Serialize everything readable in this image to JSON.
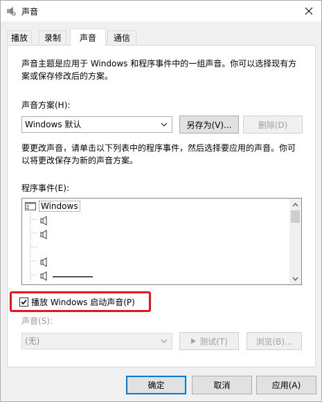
{
  "window": {
    "title": "声音",
    "close_icon": "close-icon"
  },
  "tabs": [
    {
      "label": "播放",
      "active": false
    },
    {
      "label": "录制",
      "active": false
    },
    {
      "label": "声音",
      "active": true
    },
    {
      "label": "通信",
      "active": false
    }
  ],
  "panel": {
    "intro_line1": "声音主题是应用于 Windows 和程序事件中的一组声音。你可以选择现有方",
    "intro_line2": "案或保存修改后的方案。",
    "scheme_label": "声音方案(H):",
    "scheme_value": "Windows 默认",
    "save_as_label": "另存为(V)...",
    "delete_label": "删除(D)",
    "change_line1": "要更改声音，请单击以下列表中的程序事件，然后选择要应用的声音。你可",
    "change_line2": "以将更改保存为新的声音方案。",
    "events_label": "程序事件(E):",
    "events_root": "Windows",
    "startup_checkbox_label": "播放 Windows 启动声音(P)",
    "startup_checked": true,
    "sound_label": "声音(S):",
    "sound_value": "(无)",
    "test_label": "测试(T)",
    "browse_label": "浏览(B)..."
  },
  "footer": {
    "ok_label": "确定",
    "cancel_label": "取消",
    "apply_label": "应用(A)"
  },
  "colors": {
    "accent": "#0078d7",
    "highlight": "#e8141d"
  }
}
